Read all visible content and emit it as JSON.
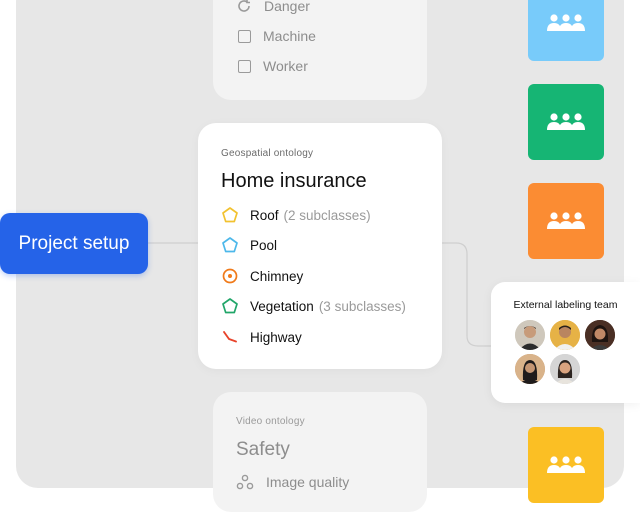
{
  "project_button": {
    "label": "Project setup"
  },
  "top_ontology": {
    "items": [
      {
        "label": "Danger",
        "icon": "refresh-icon"
      },
      {
        "label": "Machine",
        "icon": "checkbox-icon"
      },
      {
        "label": "Worker",
        "icon": "checkbox-icon"
      }
    ]
  },
  "main_ontology": {
    "subtitle": "Geospatial ontology",
    "title": "Home insurance",
    "classes": [
      {
        "label": "Roof",
        "note": "(2 subclasses)",
        "icon": "pentagon-outline-icon",
        "color": "#f2c230"
      },
      {
        "label": "Pool",
        "note": "",
        "icon": "pentagon-outline-icon",
        "color": "#4db8ea"
      },
      {
        "label": "Chimney",
        "note": "",
        "icon": "target-circle-icon",
        "color": "#f07a1a"
      },
      {
        "label": "Vegetation",
        "note": "(3 subclasses)",
        "icon": "pentagon-outline-icon",
        "color": "#22a66a"
      },
      {
        "label": "Highway",
        "note": "",
        "icon": "polyline-icon",
        "color": "#e8432a"
      }
    ]
  },
  "video_ontology": {
    "subtitle": "Video ontology",
    "title": "Safety",
    "items": [
      {
        "label": "Image quality",
        "icon": "nodes-icon"
      }
    ]
  },
  "teams": {
    "tiles": [
      {
        "name": "team-blue",
        "color": "#78cbfa",
        "icon": "people-group-icon"
      },
      {
        "name": "team-green",
        "color": "#16b574",
        "icon": "people-group-icon"
      },
      {
        "name": "team-orange",
        "color": "#fb8c33",
        "icon": "people-group-icon"
      },
      {
        "name": "team-yellow",
        "color": "#fbbf24",
        "icon": "people-group-icon"
      }
    ]
  },
  "external_team": {
    "title": "External labeling team",
    "member_count": 5
  }
}
